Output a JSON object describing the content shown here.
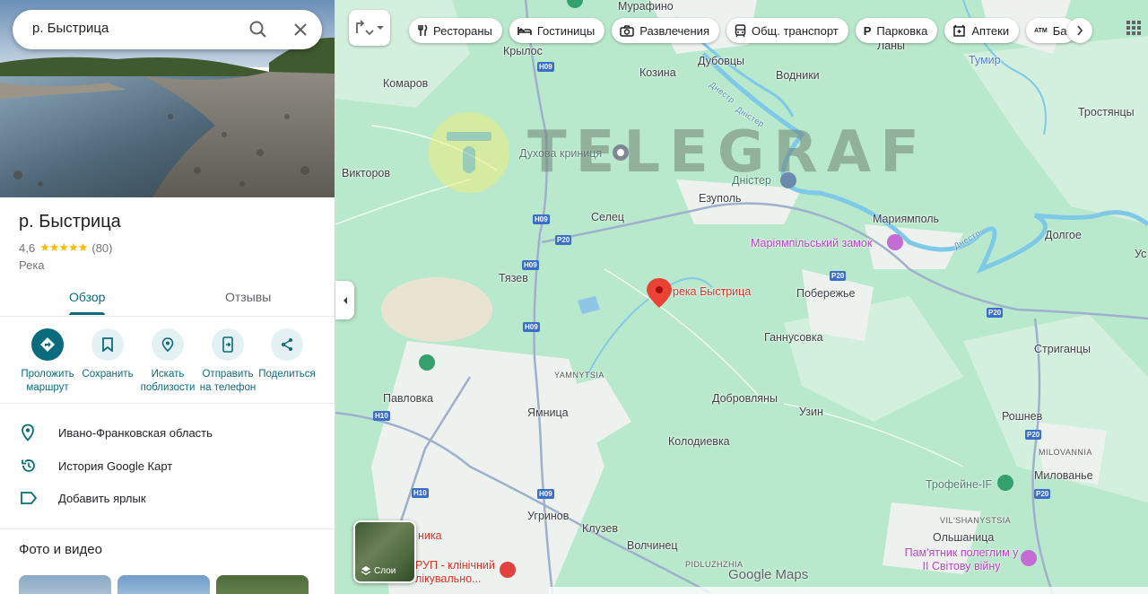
{
  "search": {
    "value": "р. Быстрица"
  },
  "place": {
    "title": "р. Быстрица",
    "rating": "4,6",
    "stars": "★★★★★",
    "reviews_count": "(80)",
    "type": "Река"
  },
  "tabs": [
    {
      "label": "Обзор"
    },
    {
      "label": "Отзывы"
    }
  ],
  "actions": [
    {
      "label": "Проложить маршрут",
      "icon": "directions-icon"
    },
    {
      "label": "Сохранить",
      "icon": "bookmark-icon"
    },
    {
      "label": "Искать поблизости",
      "icon": "nearby-icon"
    },
    {
      "label": "Отправить на телефон",
      "icon": "send-to-phone-icon"
    },
    {
      "label": "Поделиться",
      "icon": "share-icon"
    }
  ],
  "info": [
    {
      "text": "Ивано-Франковская область",
      "icon": "location-pin-icon"
    },
    {
      "text": "История Google Карт",
      "icon": "history-icon"
    },
    {
      "text": "Добавить ярлык",
      "icon": "label-icon"
    }
  ],
  "photos_title": "Фото и видео",
  "chips": [
    {
      "label": "Рестораны",
      "icon": "restaurant-icon"
    },
    {
      "label": "Гостиницы",
      "icon": "hotel-icon"
    },
    {
      "label": "Развлечения",
      "icon": "camera-icon"
    },
    {
      "label": "Общ. транспорт",
      "icon": "transit-icon"
    },
    {
      "label": "Парковка",
      "icon": "parking-icon"
    },
    {
      "label": "Аптеки",
      "icon": "pharmacy-icon"
    },
    {
      "label": "Ба",
      "icon": "atm-icon"
    }
  ],
  "layers_label": "Слои",
  "map_labels": {
    "murafino": "Мурафино",
    "krylos": "Крылос",
    "komarov": "Комаров",
    "kozina": "Козина",
    "dubovtsy": "Дубовцы",
    "vodniki": "Водники",
    "lany": "Ланы",
    "tumir": "Тумир",
    "trostyantsy": "Тростянцы",
    "viktorov": "Викторов",
    "dukhova": "Духова криниця",
    "dnister": "Дністер",
    "ezupol": "Езуполь",
    "mariyampol": "Мариямполь",
    "zamok": "Маріямпільський замок",
    "dolgoe": "Долгое",
    "selets": "Селец",
    "tyazev": "Тязев",
    "reka": "река Быстрица",
    "poberezhe": "Побережье",
    "gannusovka": "Ганнусовка",
    "striganty": "Стриганцы",
    "yamnytsia_en": "YAMNYTSIA",
    "pavlovka": "Павловка",
    "yamnitsa": "Ямница",
    "dobrovlyany": "Добровляны",
    "uzin": "Узин",
    "roshnev": "Рошнев",
    "kolodievka": "Колодиевка",
    "milovanya_en": "MILOVANNIA",
    "milovane": "Милованье",
    "trofeine": "Трофейне-IF",
    "vilshanystsia": "VIL'SHANYSTSIA",
    "olshanitsa": "Ольшаница",
    "pamyatnik": "Пам'ятник полеглим у ІІ Світову війну",
    "ugrinov": "Угринов",
    "kluzev": "Клузев",
    "volchinets": "Волчинец",
    "pidluzhzhia": "PIDLUZHZHIA",
    "hospital": "РУП - клінічний лікувально...",
    "nika": "ника",
    "dnestr_river": "Днестр",
    "dnestr_river2": "Днестр",
    "dnister2": "Дністер",
    "us": "Ус",
    "roads": [
      "H09",
      "H09",
      "H09",
      "H09",
      "P20",
      "P20",
      "P20",
      "P20",
      "P20",
      "H10",
      "H10",
      "H09"
    ]
  },
  "google_maps": "Google Maps",
  "watermark": "TELEGRAF",
  "colors": {
    "accent": "#0a6b7c",
    "map_bg": "#b9e9cc",
    "pin": "#ea4335"
  }
}
